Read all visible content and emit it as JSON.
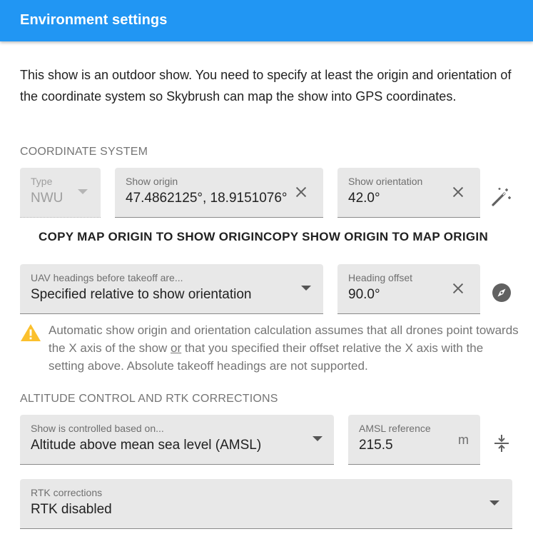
{
  "dialog": {
    "title": "Environment settings"
  },
  "intro": {
    "text": "This show is an outdoor show. You need to specify at least the origin and orientation of the coordinate system so Skybrush can map the show into GPS coordinates."
  },
  "coordinate_system": {
    "section_label": "COORDINATE SYSTEM",
    "type": {
      "label": "Type",
      "value": "NWU",
      "disabled": true
    },
    "show_origin": {
      "label": "Show origin",
      "value": "47.4862125°, 18.9151076°"
    },
    "show_orientation": {
      "label": "Show orientation",
      "value": "42.0°"
    },
    "copy_map_to_show_label": "COPY MAP ORIGIN TO SHOW ORIGIN",
    "copy_show_to_map_label": "COPY SHOW ORIGIN TO MAP ORIGIN",
    "uav_headings": {
      "label": "UAV headings before takeoff are...",
      "value": "Specified relative to show orientation"
    },
    "heading_offset": {
      "label": "Heading offset",
      "value": "90.0°"
    }
  },
  "warning": {
    "text_before": "Automatic show origin and orientation calculation assumes that all drones point towards the X axis of the show ",
    "text_underlined": "or",
    "text_after": " that you specified their offset relative the X axis with the setting above. Absolute takeoff headings are not supported.",
    "color": "#fbc02d"
  },
  "altitude": {
    "section_label": "ALTITUDE CONTROL AND RTK CORRECTIONS",
    "control_mode": {
      "label": "Show is controlled based on...",
      "value": "Altitude above mean sea level (AMSL)"
    },
    "amsl_reference": {
      "label": "AMSL reference",
      "value": "215.5",
      "unit": "m"
    },
    "rtk": {
      "label": "RTK corrections",
      "value": "RTK disabled"
    }
  },
  "colors": {
    "accent": "#2196f3",
    "field_bg": "#e8e8e8"
  },
  "icons": {
    "clear": "close-icon",
    "auto_calc": "magic-wand-icon",
    "compass": "compass-icon",
    "altitude": "vertical-align-center-icon",
    "warning": "warning-icon"
  }
}
